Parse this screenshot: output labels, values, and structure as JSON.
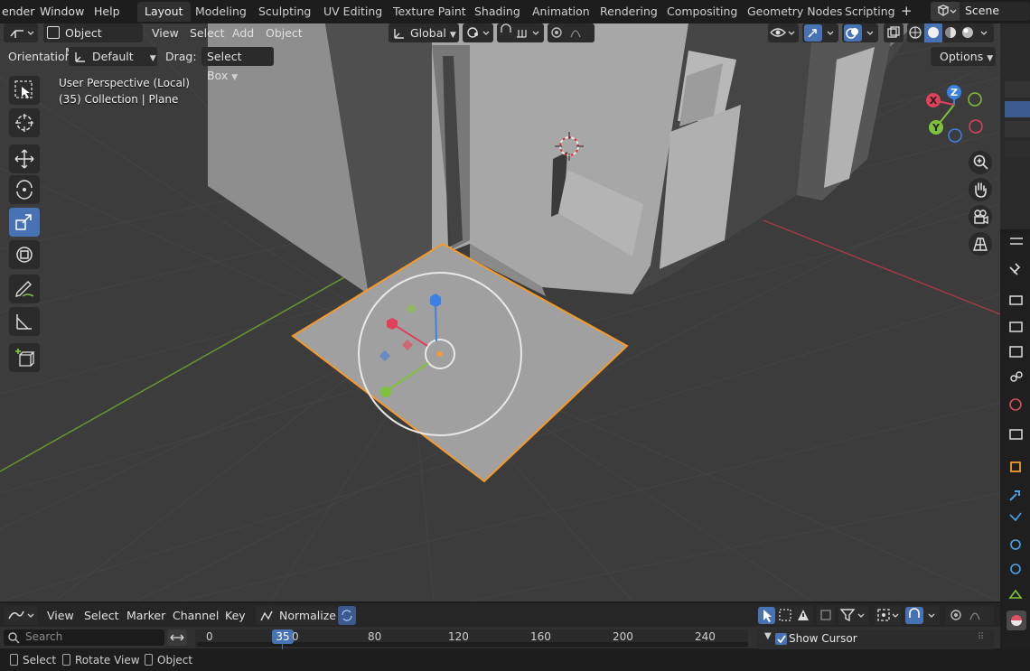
{
  "menubar": {
    "items": [
      "ender",
      "Window",
      "Help"
    ],
    "workspaces": [
      "Layout",
      "Modeling",
      "Sculpting",
      "UV Editing",
      "Texture Paint",
      "Shading",
      "Animation",
      "Rendering",
      "Compositing",
      "Geometry Nodes",
      "Scripting"
    ],
    "active_workspace": "Layout",
    "add_label": "+",
    "scene_name": "Scene"
  },
  "viewport_header": {
    "mode": "Object Mode",
    "menus": [
      "View",
      "Select",
      "Add",
      "Object"
    ],
    "transform_orientation": "Global",
    "orientation_label": "Orientation:",
    "orientation_value": "Default",
    "drag_label": "Drag:",
    "drag_value": "Select Box",
    "options_label": "Options"
  },
  "viewport_overlay": {
    "perspective": "User Perspective (Local)",
    "collection": "(35) Collection | Plane"
  },
  "gizmo": {
    "x_label": "X",
    "y_label": "Y",
    "z_label": "Z",
    "x_color": "#e0405a",
    "y_color": "#7ec13a",
    "z_color": "#3b82e4"
  },
  "toolbar": {
    "tools": [
      "select-box",
      "cursor",
      "move",
      "rotate",
      "scale",
      "transform",
      "annotate",
      "measure",
      "add-cube"
    ],
    "active_tool": "scale"
  },
  "timeline": {
    "menus": [
      "View",
      "Select",
      "Marker",
      "Channel",
      "Key"
    ],
    "normalize_label": "Normalize",
    "search_placeholder": "Search",
    "ticks": [
      "0",
      "80",
      "120",
      "160",
      "200",
      "240"
    ],
    "current_frame": "35",
    "frame_suffix": "0",
    "show_cursor_label": "Show Cursor",
    "show_cursor_checked": true
  },
  "statusbar": {
    "items": [
      "Select",
      "Rotate View",
      "Object"
    ]
  },
  "colors": {
    "selection_outline": "#f39a2b",
    "active_tool": "#4772b3",
    "x_axis_line": "#a63a48",
    "y_axis_line": "#6a9b2c"
  }
}
